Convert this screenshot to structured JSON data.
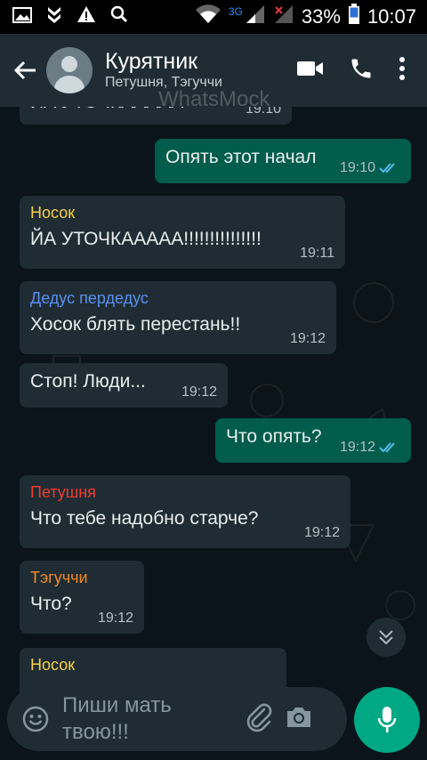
{
  "status_bar": {
    "network": "3G",
    "battery": "33%",
    "time": "10:07"
  },
  "header": {
    "title": "Курятник",
    "subtitle": "Петушня, Тэгуччи"
  },
  "watermark": "WhatsMock",
  "messages": [
    {
      "dir": "in",
      "text": "ЙА УТОЧКААААА",
      "time": "19:10"
    },
    {
      "dir": "out",
      "text": "Опять этот начал",
      "time": "19:10",
      "ticks": "read"
    },
    {
      "dir": "in",
      "sender": "Носок",
      "sender_color": "#f7d046",
      "text": "ЙА УТОЧКААААА!!!!!!!!!!!!!!!",
      "time": "19:11"
    },
    {
      "dir": "in",
      "sender": "Дедус пердедус",
      "sender_color": "#5b8ff0",
      "text": "Хосок блять перестань!!",
      "time": "19:12"
    },
    {
      "dir": "in",
      "text": "Стоп! Люди...",
      "time": "19:12"
    },
    {
      "dir": "out",
      "text": "Что опять?",
      "time": "19:12",
      "ticks": "read"
    },
    {
      "dir": "in",
      "sender": "Петушня",
      "sender_color": "#f23c2e",
      "text": "Что тебе надобно старче?",
      "time": "19:12"
    },
    {
      "dir": "in",
      "sender": "Тэгуччи",
      "sender_color": "#f08a24",
      "text": "Что?",
      "time": "19:12"
    },
    {
      "dir": "in",
      "sender": "Носок",
      "sender_color": "#f7d046",
      "text": "",
      "time": ""
    }
  ],
  "input": {
    "placeholder": "Пиши мать твою!!!"
  },
  "colors": {
    "header_bg": "#1f2c34",
    "incoming_bubble": "#1f2c34",
    "outgoing_bubble": "#005c4b",
    "accent": "#00a884",
    "read_ticks": "#53bdeb"
  }
}
